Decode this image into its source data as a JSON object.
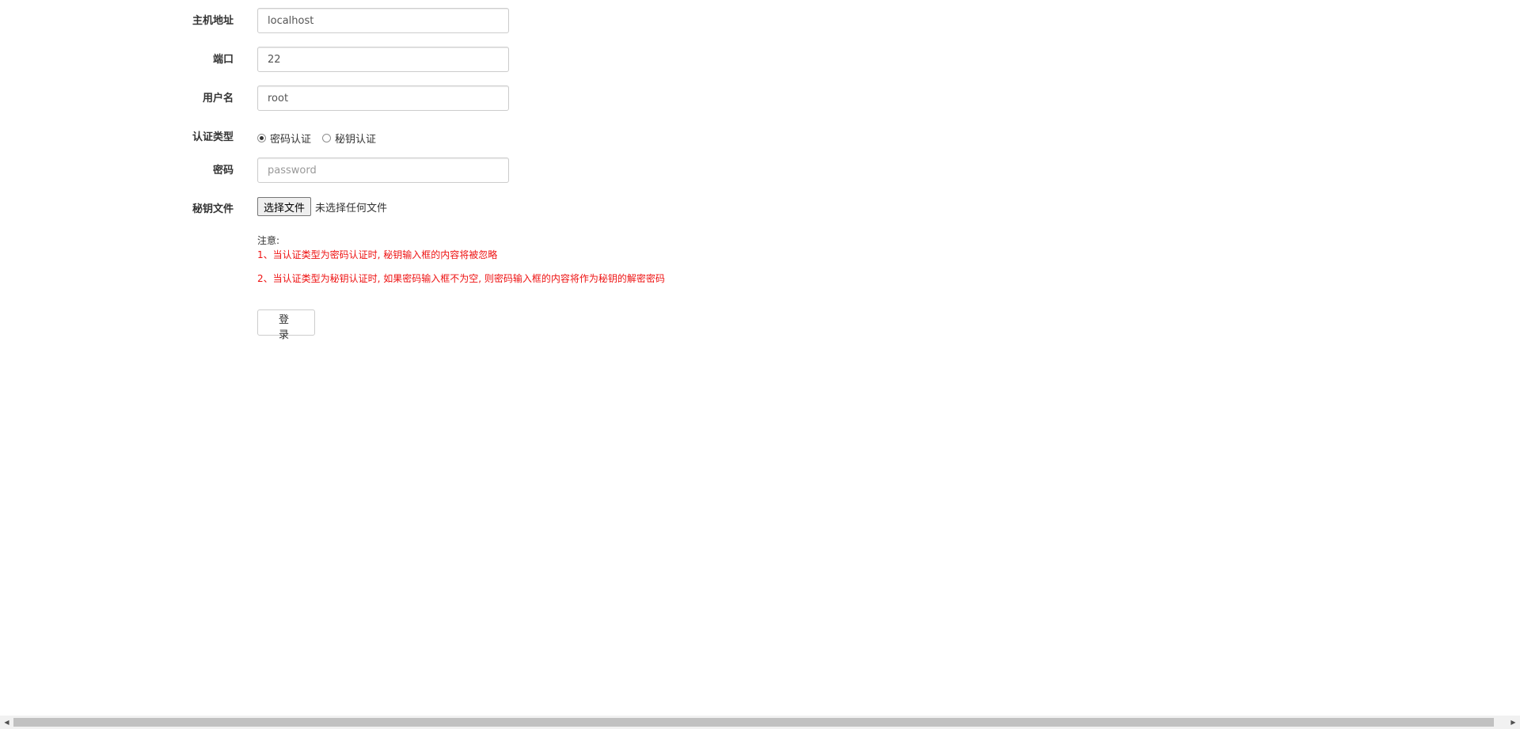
{
  "form": {
    "host": {
      "label": "主机地址",
      "value": "localhost"
    },
    "port": {
      "label": "端口",
      "value": "22"
    },
    "username": {
      "label": "用户名",
      "value": "root"
    },
    "auth_type": {
      "label": "认证类型",
      "options": [
        {
          "label": "密码认证",
          "checked": true
        },
        {
          "label": "秘钥认证",
          "checked": false
        }
      ]
    },
    "password": {
      "label": "密码",
      "placeholder": "password",
      "value": ""
    },
    "key_file": {
      "label": "秘钥文件",
      "button_label": "选择文件",
      "status": "未选择任何文件"
    }
  },
  "notes": {
    "title": "注意:",
    "lines": [
      "1、当认证类型为密码认证时, 秘钥输入框的内容将被忽略",
      "2、当认证类型为秘钥认证时, 如果密码输入框不为空, 则密码输入框的内容将作为秘钥的解密密码"
    ]
  },
  "login_button": {
    "label": "登录"
  },
  "colors": {
    "note_text": "#ee1111",
    "label_text": "#333333",
    "input_border": "#cccccc"
  }
}
